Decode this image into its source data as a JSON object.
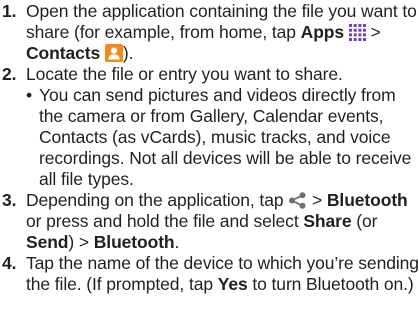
{
  "steps": [
    {
      "number": "1.",
      "text_1": "Open the application containing the file you want to share (for example, from home, tap ",
      "apps": "Apps",
      "sep": " > ",
      "contacts": "Contacts",
      "text_end": ")."
    },
    {
      "number": "2.",
      "text": "Locate the file or entry you want to share.",
      "bullet": "•",
      "bullet_text": "You can send pictures and videos directly from the camera or from Gallery, Calendar events, Contacts (as vCards), music tracks, and voice recordings. Not all devices will be able to receive all file types."
    },
    {
      "number": "3.",
      "text_1": "Depending on the application, tap ",
      "sep_1": " > ",
      "bluetooth_1": "Bluetooth",
      "text_2": " or press and hold the file and select ",
      "share": "Share",
      "paren_open": " (or ",
      "send": "Send",
      "paren_close": ") > ",
      "bluetooth_2": "Bluetooth",
      "period": "."
    },
    {
      "number": "4.",
      "text_1": "Tap the name of the device to which you’re sending the file. (If prompted, tap ",
      "yes": "Yes",
      "text_2": " to turn Bluetooth on.)"
    }
  ],
  "icons": {
    "apps_grid": "apps-grid-icon",
    "contacts": "contacts-icon",
    "share": "share-icon"
  },
  "colors": {
    "text": "#231f20",
    "apps_icon": "#7b3fb4",
    "contacts_icon": "#f08a1c",
    "share_icon": "#6d6e71"
  }
}
